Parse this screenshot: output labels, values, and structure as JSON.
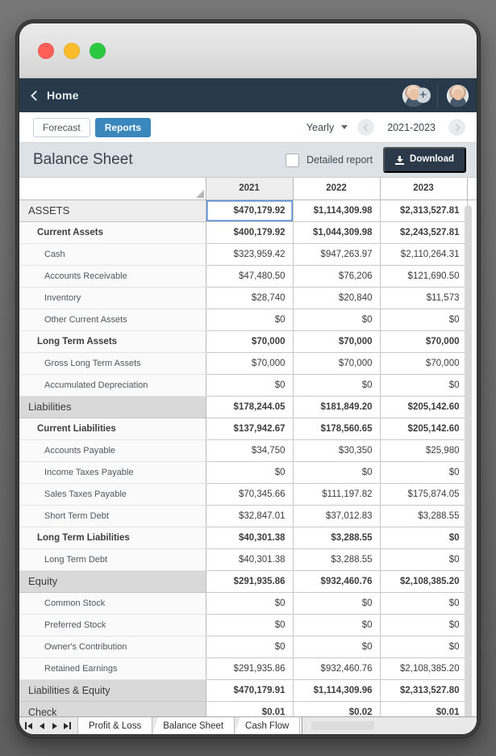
{
  "window": {
    "traffic_lights": [
      "close",
      "minimize",
      "zoom"
    ]
  },
  "appbar": {
    "home_label": "Home",
    "back_icon": "chevron-left-icon",
    "avatar_add_icon": "add-person-icon"
  },
  "toolbar": {
    "forecast_label": "Forecast",
    "reports_label": "Reports",
    "frequency": "Yearly",
    "range": "2021-2023",
    "prev_icon": "chevron-left-icon",
    "next_icon": "chevron-right-icon",
    "accent_color": "#3a87bd"
  },
  "report": {
    "title": "Balance Sheet",
    "detailed_label": "Detailed report",
    "detailed_checked": false,
    "download_label": "Download",
    "download_icon": "download-icon",
    "download_color": "#2b3949"
  },
  "grid": {
    "columns": [
      "2021",
      "2022",
      "2023"
    ],
    "active_column": "2021",
    "rows": [
      {
        "level": 0,
        "section": true,
        "label": "ASSETS",
        "values": [
          "$470,179.92",
          "$1,114,309.98",
          "$2,313,527.81"
        ],
        "selected": true
      },
      {
        "level": 1,
        "label": "Current Assets",
        "values": [
          "$400,179.92",
          "$1,044,309.98",
          "$2,243,527.81"
        ]
      },
      {
        "level": 2,
        "label": "Cash",
        "values": [
          "$323,959.42",
          "$947,263.97",
          "$2,110,264.31"
        ]
      },
      {
        "level": 2,
        "label": "Accounts Receivable",
        "values": [
          "$47,480.50",
          "$76,206",
          "$121,690.50"
        ]
      },
      {
        "level": 2,
        "label": "Inventory",
        "values": [
          "$28,740",
          "$20,840",
          "$11,573"
        ]
      },
      {
        "level": 2,
        "label": "Other Current Assets",
        "values": [
          "$0",
          "$0",
          "$0"
        ]
      },
      {
        "level": 1,
        "label": "Long Term Assets",
        "values": [
          "$70,000",
          "$70,000",
          "$70,000"
        ]
      },
      {
        "level": 2,
        "label": "Gross Long Term Assets",
        "values": [
          "$70,000",
          "$70,000",
          "$70,000"
        ]
      },
      {
        "level": 2,
        "label": "Accumulated Depreciation",
        "values": [
          "$0",
          "$0",
          "$0"
        ]
      },
      {
        "level": 0,
        "label": "Liabilities",
        "values": [
          "$178,244.05",
          "$181,849.20",
          "$205,142.60"
        ]
      },
      {
        "level": 1,
        "label": "Current Liabilities",
        "values": [
          "$137,942.67",
          "$178,560.65",
          "$205,142.60"
        ]
      },
      {
        "level": 2,
        "label": "Accounts Payable",
        "values": [
          "$34,750",
          "$30,350",
          "$25,980"
        ]
      },
      {
        "level": 2,
        "label": "Income Taxes Payable",
        "values": [
          "$0",
          "$0",
          "$0"
        ]
      },
      {
        "level": 2,
        "label": "Sales Taxes Payable",
        "values": [
          "$70,345.66",
          "$111,197.82",
          "$175,874.05"
        ]
      },
      {
        "level": 2,
        "label": "Short Term Debt",
        "values": [
          "$32,847.01",
          "$37,012.83",
          "$3,288.55"
        ]
      },
      {
        "level": 1,
        "label": "Long Term Liabilities",
        "values": [
          "$40,301.38",
          "$3,288.55",
          "$0"
        ]
      },
      {
        "level": 2,
        "label": "Long Term Debt",
        "values": [
          "$40,301.38",
          "$3,288.55",
          "$0"
        ]
      },
      {
        "level": 0,
        "label": "Equity",
        "values": [
          "$291,935.86",
          "$932,460.76",
          "$2,108,385.20"
        ]
      },
      {
        "level": 2,
        "label": "Common Stock",
        "values": [
          "$0",
          "$0",
          "$0"
        ]
      },
      {
        "level": 2,
        "label": "Preferred Stock",
        "values": [
          "$0",
          "$0",
          "$0"
        ]
      },
      {
        "level": 2,
        "label": "Owner's Contribution",
        "values": [
          "$0",
          "$0",
          "$0"
        ]
      },
      {
        "level": 2,
        "label": "Retained Earnings",
        "values": [
          "$291,935.86",
          "$932,460.76",
          "$2,108,385.20"
        ]
      },
      {
        "level": 0,
        "total": true,
        "label": "Liabilities & Equity",
        "values": [
          "$470,179.91",
          "$1,114,309.96",
          "$2,313,527.80"
        ]
      },
      {
        "level": 0,
        "total": true,
        "label": "Check",
        "values": [
          "$0.01",
          "$0.02",
          "$0.01"
        ]
      }
    ]
  },
  "sheet_tabs": {
    "nav": [
      "first-sheet",
      "previous-sheet",
      "next-sheet",
      "last-sheet"
    ],
    "tabs": [
      {
        "label": "Profit & Loss",
        "active": false
      },
      {
        "label": "Balance Sheet",
        "active": true
      },
      {
        "label": "Cash Flow",
        "active": false
      }
    ]
  }
}
